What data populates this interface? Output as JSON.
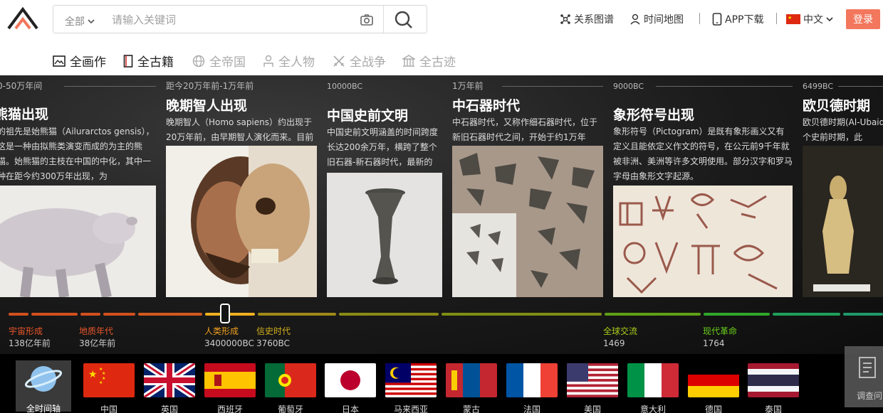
{
  "header": {
    "scope_label": "全部",
    "search_placeholder": "请输入关键词",
    "links": [
      {
        "label": "关系图谱",
        "icon": "network-icon"
      },
      {
        "label": "时间地图",
        "icon": "location-person-icon"
      },
      {
        "label": "APP下载",
        "icon": "phone-icon"
      },
      {
        "label": "中文",
        "icon": "china-flag-icon"
      }
    ],
    "login_label": "登录",
    "accent_color": "#f2775c"
  },
  "nav": [
    {
      "label": "全画作",
      "icon": "painting-icon",
      "active": true
    },
    {
      "label": "全古籍",
      "icon": "book-icon",
      "active": true
    },
    {
      "label": "全帝国",
      "icon": "globe-icon",
      "active": false
    },
    {
      "label": "全人物",
      "icon": "person-icon",
      "active": false
    },
    {
      "label": "全战争",
      "icon": "crossed-swords-icon",
      "active": false
    },
    {
      "label": "全古迹",
      "icon": "temple-icon",
      "active": false
    }
  ],
  "cards": [
    {
      "date": "0-50万年间",
      "title": "熊猫出现",
      "desc": "的祖先是始熊猫（Ailurarctos gensis），这是一种由拟熊类演变而成的为主的熊猫。始熊猫的主枝在中国的中化，其中一种在距今约300万年出现，为"
    },
    {
      "date": "距今20万年前-1万年前",
      "title": "晚期智人出现",
      "desc": "晚期智人（Homo sapiens）约出现于20万年前，由早期智人演化而来。目前"
    },
    {
      "date": "10000BC",
      "title": "中国史前文明",
      "desc": "中国史前文明涵盖的时间跨度长达200余万年，横跨了整个旧石器-新石器时代，最新的"
    },
    {
      "date": "1万年前",
      "title": "中石器时代",
      "desc": "中石器时代，又称作细石器时代，位于新旧石器时代之间，开始于约1万年"
    },
    {
      "date": "9000BC",
      "title": "象形符号出现",
      "desc": "象形符号（Pictogram）是既有象形画义又有定义且能依定义作文的符号，在公元前9千年就被非洲、美洲等许多文明使用。部分汉字和罗马字母由象形文字起源。"
    },
    {
      "date": "6499BC",
      "title": "欧贝德时期",
      "desc": "欧贝德时期(Al-Ubaid的一个史前时期，此"
    }
  ],
  "timeline": {
    "eras": [
      {
        "name": "宇宙形成",
        "year": "138亿年前",
        "color": "#e8562a"
      },
      {
        "name": "地质年代",
        "year": "38亿年前",
        "color": "#e8562a"
      },
      {
        "name": "人类形成",
        "year": "3400000BC",
        "color": "#f0a020"
      },
      {
        "name": "信史时代",
        "year": "3760BC",
        "color": "#d4b01c"
      },
      {
        "name": "全球交流",
        "year": "1469",
        "color": "#a8cc1c"
      },
      {
        "name": "现代革命",
        "year": "1764",
        "color": "#6cd21c"
      }
    ]
  },
  "countries": {
    "all_label": "全时间轴",
    "items": [
      "中国",
      "英国",
      "西班牙",
      "葡萄牙",
      "日本",
      "马来西亚",
      "蒙古",
      "法国",
      "美国",
      "意大利",
      "德国",
      "泰国"
    ]
  },
  "survey_label": "调查问"
}
